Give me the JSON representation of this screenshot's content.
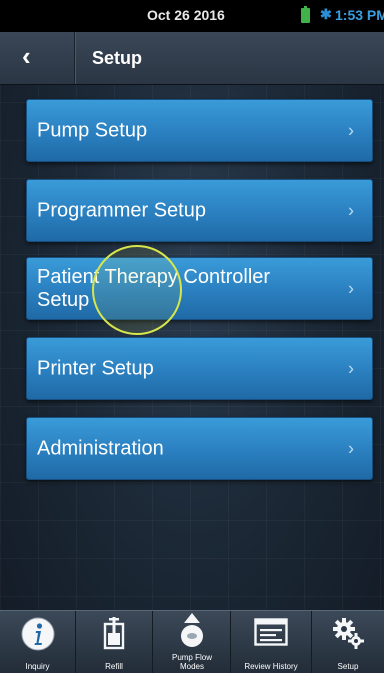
{
  "status_bar": {
    "date": "Oct 26 2016",
    "time": "1:53 PM"
  },
  "header": {
    "back_label": "‹",
    "title": "Setup"
  },
  "menu": {
    "items": [
      {
        "label": "Pump Setup",
        "chevron": "›"
      },
      {
        "label": "Programmer Setup",
        "chevron": "›"
      },
      {
        "label": "Patient Therapy Controller Setup",
        "chevron": "›"
      },
      {
        "label": "Printer Setup",
        "chevron": "›"
      },
      {
        "label": "Administration",
        "chevron": "›"
      }
    ]
  },
  "tabs": [
    {
      "label": "Inquiry",
      "icon": "info-icon"
    },
    {
      "label": "Refill",
      "icon": "refill-icon"
    },
    {
      "label": "Pump Flow Modes",
      "icon": "pump-icon"
    },
    {
      "label": "Review History",
      "icon": "history-icon"
    },
    {
      "label": "Setup",
      "icon": "gears-icon"
    }
  ],
  "colors": {
    "button": "#2a7fbf",
    "titlebar": "#2b3644",
    "time": "#3a9fe0",
    "battery": "#3fb24a",
    "touch_ring": "#d7e64a"
  }
}
